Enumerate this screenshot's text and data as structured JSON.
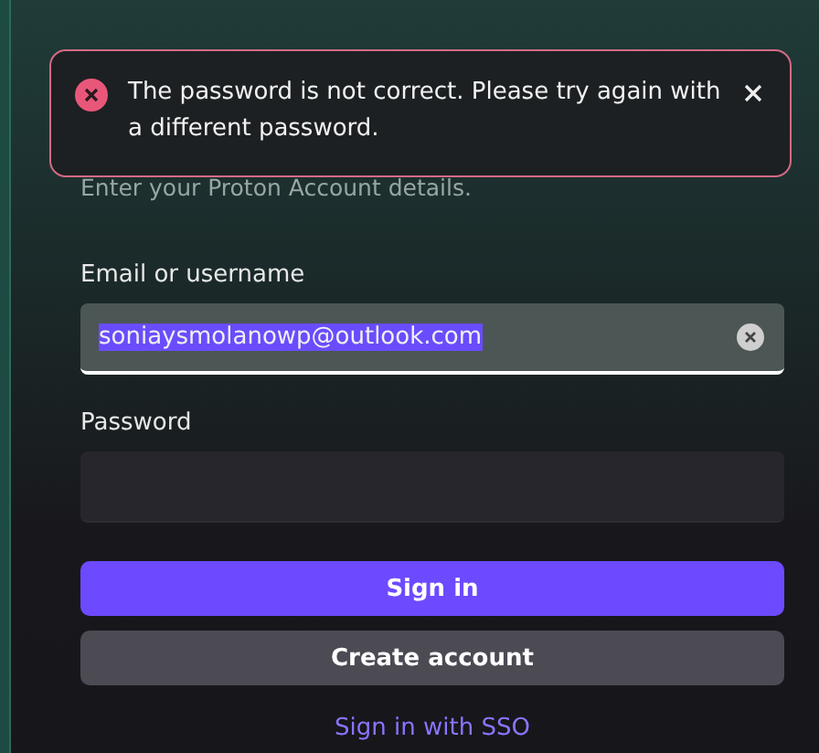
{
  "toast": {
    "kind": "error",
    "message": "The password is not correct. Please try again with a different password."
  },
  "subtitle": "Enter your Proton Account details.",
  "fields": [
    {
      "label": "Email or username",
      "value": "soniaysmolanowp@outlook.com",
      "value_selected": true,
      "focused": true,
      "clearable": true
    },
    {
      "label": "Password",
      "focused": false,
      "clearable": false
    }
  ],
  "buttons": [
    {
      "label": "Sign in",
      "kind": "primary"
    },
    {
      "label": "Create account",
      "kind": "secondary"
    }
  ],
  "link": "Sign in with SSO"
}
